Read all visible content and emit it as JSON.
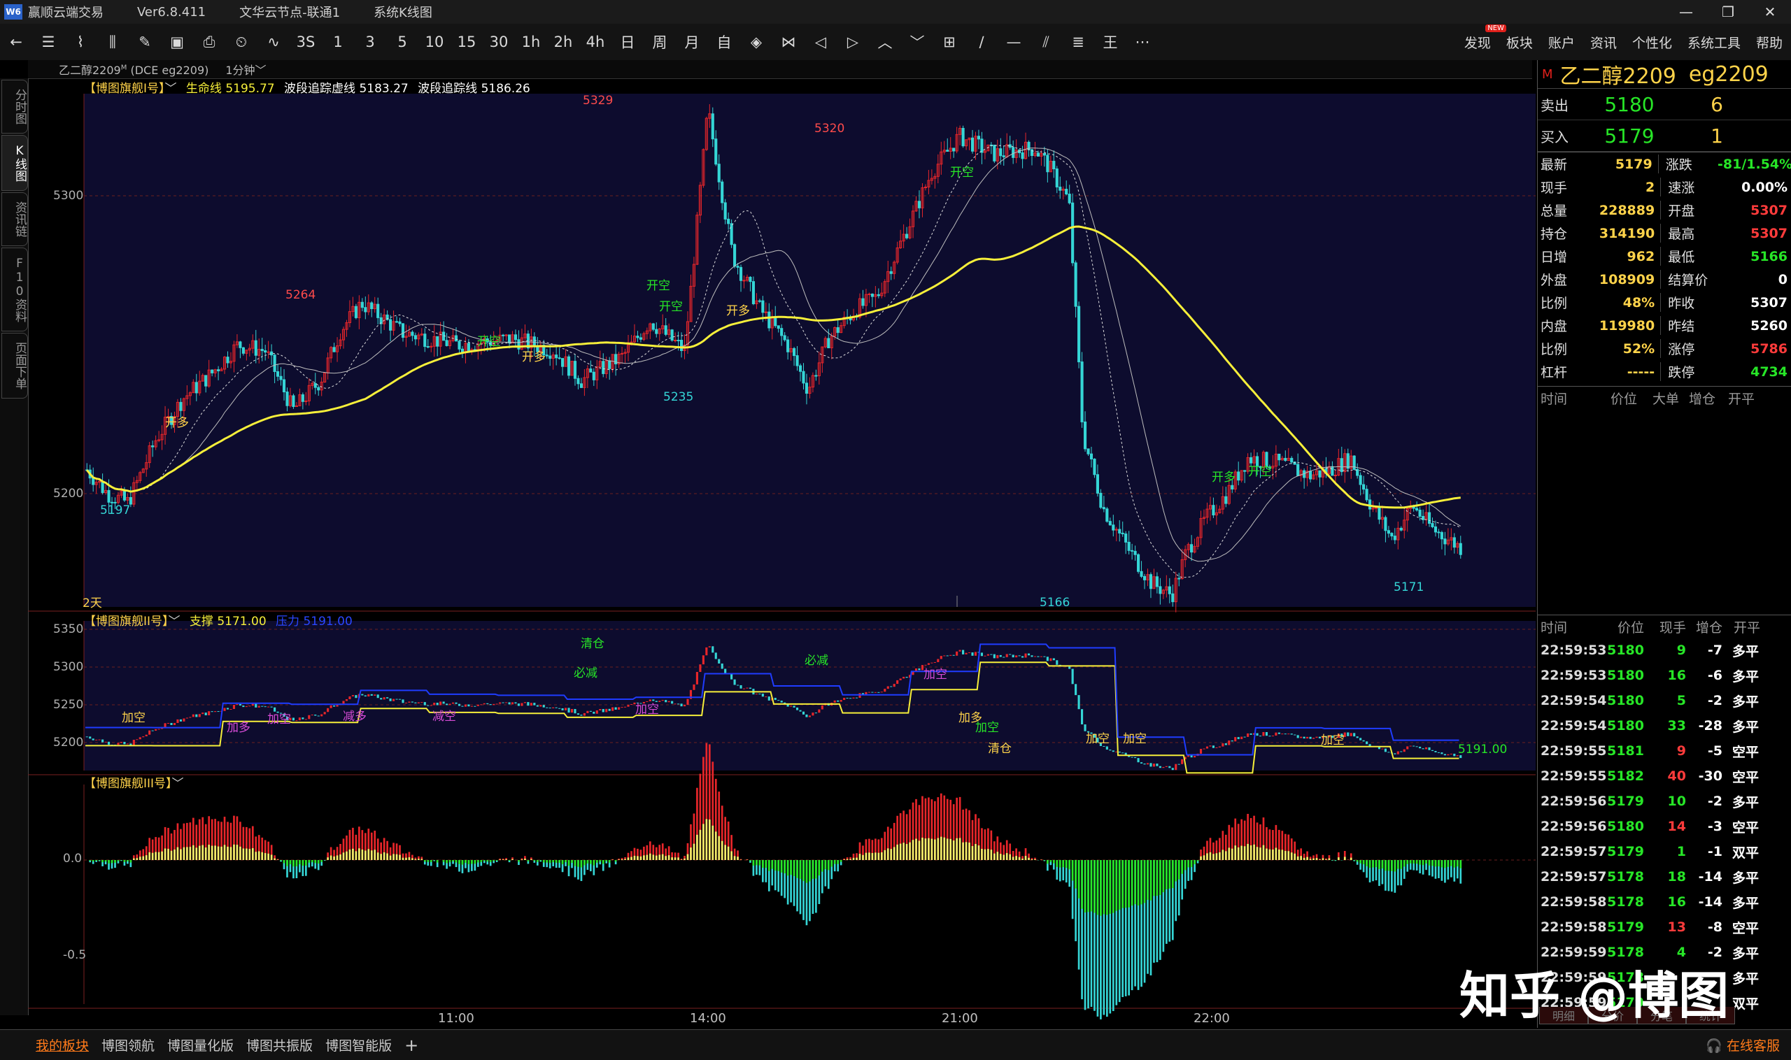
{
  "titlebar": {
    "app": "赢顺云端交易",
    "version": "Ver6.8.411",
    "node": "文华云节点-联通1",
    "mode": "系统K线图"
  },
  "toolbar": {
    "periods": [
      "1",
      "3",
      "5",
      "10",
      "15",
      "30",
      "1h",
      "2h",
      "4h",
      "日",
      "周",
      "月",
      "自"
    ],
    "icon_3s": "3S",
    "right_menu": [
      "发现",
      "板块",
      "账户",
      "资讯",
      "个性化",
      "系统工具",
      "帮助"
    ],
    "new_badge": "NEW"
  },
  "subbar": {
    "contract": "乙二醇2209",
    "sup": "M",
    "code": "(DCE eg2209)",
    "period": "1分钟"
  },
  "sidebar_tabs": [
    "分时图",
    "K线图",
    "资讯链",
    "F10资料",
    "页面下单"
  ],
  "panel1": {
    "legend_name": "【博图旗舰I号】",
    "lifeline_label": "生命线",
    "lifeline_value": "5195.77",
    "dash_label": "波段追踪虚线",
    "dash_value": "5183.27",
    "track_label": "波段追踪线",
    "track_value": "5186.26",
    "ylabels": [
      "5300",
      "5200"
    ],
    "span_label": "2天",
    "price_marks": [
      "5329",
      "5320",
      "5264",
      "5235",
      "5197",
      "5166",
      "5171"
    ],
    "signals": [
      "开多",
      "开多",
      "开空",
      "开空",
      "开多",
      "开多",
      "开空",
      "开空",
      "开空"
    ]
  },
  "panel2": {
    "legend_name": "【博图旗舰II号】",
    "support_label": "支撑",
    "support_value": "5171.00",
    "resist_label": "压力",
    "resist_value": "5191.00",
    "ylabels": [
      "5350",
      "5300",
      "5250",
      "5200"
    ],
    "last_value": "5191.00",
    "signals": [
      "清仓",
      "必减",
      "必减",
      "加多",
      "加空",
      "加空",
      "减多",
      "减空",
      "加空",
      "加多",
      "加空",
      "清仓",
      "加空",
      "加空",
      "加空",
      "加空"
    ]
  },
  "panel3": {
    "legend_name": "【博图旗舰III号】",
    "ylabels": [
      "0.0",
      "-0.5"
    ]
  },
  "time_axis": [
    "11:00",
    "14:00",
    "21:00",
    "22:00"
  ],
  "quote": {
    "marker": "M",
    "name": "乙二醇2209",
    "code": "eg2209",
    "sell_label": "卖出",
    "sell_price": "5180",
    "sell_vol": "6",
    "buy_label": "买入",
    "buy_price": "5179",
    "buy_vol": "1",
    "stats": [
      {
        "k": "最新",
        "v": "5179",
        "vc": "#ffd34a",
        "k2": "涨跌",
        "v2": "-81/1.54%",
        "v2c": "#27e627"
      },
      {
        "k": "现手",
        "v": "2",
        "vc": "#ffd34a",
        "k2": "速涨",
        "v2": "0.00%",
        "v2c": "#ffffff"
      },
      {
        "k": "总量",
        "v": "228889",
        "vc": "#ffd34a",
        "k2": "开盘",
        "v2": "5307",
        "v2c": "#ff3b3b"
      },
      {
        "k": "持仓",
        "v": "314190",
        "vc": "#ffd34a",
        "k2": "最高",
        "v2": "5307",
        "v2c": "#ff3b3b"
      },
      {
        "k": "日增",
        "v": "962",
        "vc": "#ffd34a",
        "k2": "最低",
        "v2": "5166",
        "v2c": "#27e627"
      },
      {
        "k": "外盘",
        "v": "108909",
        "vc": "#ffd34a",
        "k2": "结算价",
        "v2": "0",
        "v2c": "#ffffff"
      },
      {
        "k": "比例",
        "v": "48%",
        "vc": "#ffd34a",
        "k2": "昨收",
        "v2": "5307",
        "v2c": "#ffffff"
      },
      {
        "k": "内盘",
        "v": "119980",
        "vc": "#ffd34a",
        "k2": "昨结",
        "v2": "5260",
        "v2c": "#ffffff"
      },
      {
        "k": "比例",
        "v": "52%",
        "vc": "#ffd34a",
        "k2": "涨停",
        "v2": "5786",
        "v2c": "#ff3b3b"
      },
      {
        "k": "杠杆",
        "v": "-----",
        "vc": "#ffd34a",
        "k2": "跌停",
        "v2": "4734",
        "v2c": "#27e627"
      }
    ],
    "bigtrade_headers": [
      "时间",
      "价位",
      "大单",
      "增仓",
      "开平"
    ],
    "tick_headers": [
      "时间",
      "价位",
      "现手",
      "增仓",
      "开平"
    ],
    "ticks": [
      {
        "t": "22:59:53",
        "p": "5180",
        "v": "9",
        "d": "-7",
        "o": "多平",
        "pc": "#27e627",
        "vcol": "#27e627"
      },
      {
        "t": "22:59:53",
        "p": "5180",
        "v": "16",
        "d": "-6",
        "o": "多平",
        "pc": "#27e627",
        "vcol": "#27e627"
      },
      {
        "t": "22:59:54",
        "p": "5180",
        "v": "5",
        "d": "-2",
        "o": "多平",
        "pc": "#27e627",
        "vcol": "#27e627"
      },
      {
        "t": "22:59:54",
        "p": "5180",
        "v": "33",
        "d": "-28",
        "o": "多平",
        "pc": "#27e627",
        "vcol": "#27e627"
      },
      {
        "t": "22:59:55",
        "p": "5181",
        "v": "9",
        "d": "-5",
        "o": "空平",
        "pc": "#27e627",
        "vcol": "#ff3b3b"
      },
      {
        "t": "22:59:55",
        "p": "5182",
        "v": "40",
        "d": "-30",
        "o": "空平",
        "pc": "#27e627",
        "vcol": "#ff3b3b"
      },
      {
        "t": "22:59:56",
        "p": "5179",
        "v": "10",
        "d": "-2",
        "o": "多平",
        "pc": "#27e627",
        "vcol": "#27e627"
      },
      {
        "t": "22:59:56",
        "p": "5180",
        "v": "14",
        "d": "-3",
        "o": "空平",
        "pc": "#27e627",
        "vcol": "#ff3b3b"
      },
      {
        "t": "22:59:57",
        "p": "5179",
        "v": "1",
        "d": "-1",
        "o": "双平",
        "pc": "#27e627",
        "vcol": "#27e627"
      },
      {
        "t": "22:59:57",
        "p": "5178",
        "v": "18",
        "d": "-14",
        "o": "多平",
        "pc": "#27e627",
        "vcol": "#27e627"
      },
      {
        "t": "22:59:58",
        "p": "5178",
        "v": "16",
        "d": "-14",
        "o": "多平",
        "pc": "#27e627",
        "vcol": "#27e627"
      },
      {
        "t": "22:59:58",
        "p": "5179",
        "v": "13",
        "d": "-8",
        "o": "空平",
        "pc": "#27e627",
        "vcol": "#ff3b3b"
      },
      {
        "t": "22:59:59",
        "p": "5178",
        "v": "4",
        "d": "-2",
        "o": "多平",
        "pc": "#27e627",
        "vcol": "#27e627"
      },
      {
        "t": "22:59:59",
        "p": "5178",
        "v": "",
        "d": "",
        "o": "多平",
        "pc": "#27e627",
        "vcol": "#27e627"
      },
      {
        "t": "22:59:59",
        "p": "5179",
        "v": "",
        "d": "",
        "o": "双平",
        "pc": "#27e627",
        "vcol": "#27e627"
      }
    ],
    "tape_tabs": [
      "明细",
      "分价",
      "分笔",
      "统计"
    ]
  },
  "bottom_tabs": [
    "我的板块",
    "博图领航",
    "博图量化版",
    "博图共振版",
    "博图智能版"
  ],
  "add_tab": "+",
  "support_link": "在线客服",
  "watermark": "知乎 @博图",
  "colors": {
    "up": "#e8262a",
    "down": "#35d6d6",
    "lifeline": "#f6ef3a",
    "support": "#f6ef3a",
    "resist": "#1f3cff",
    "green": "#27e627",
    "yellow": "#ffd34a"
  },
  "chart_data": {
    "type": "candlestick",
    "title": "乙二醇2209 1分钟",
    "x": [
      "11:00",
      "14:00",
      "21:00",
      "22:00"
    ],
    "price_range": [
      5150,
      5335
    ],
    "key_prices": {
      "high_1": 5329,
      "high_2": 5320,
      "swing_high": 5264,
      "swing_low": 5235,
      "low_start": 5197,
      "low_1": 5166,
      "low_2": 5171
    },
    "indicators": {
      "lifeline": 5195.77,
      "dash_track": 5183.27,
      "track": 5186.26,
      "support": 5171.0,
      "resist": 5191.0
    }
  }
}
